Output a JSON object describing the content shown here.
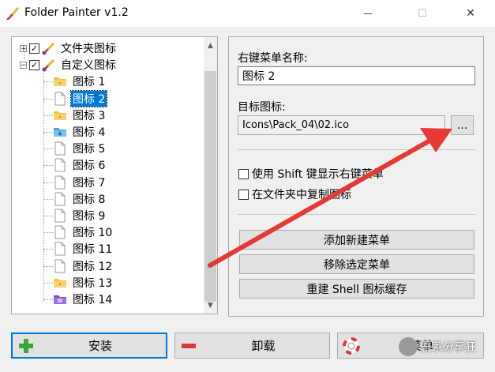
{
  "window": {
    "title": "Folder Painter v1.2",
    "minimize_glyph": "—",
    "maximize_glyph": "☐",
    "close_glyph": "✕"
  },
  "tree": {
    "nodes": [
      {
        "label": "文件夹图标",
        "level": 0,
        "expander": "+",
        "checked": true,
        "icon": "brush-icon"
      },
      {
        "label": "自定义图标",
        "level": 0,
        "expander": "−",
        "checked": true,
        "icon": "brush-icon"
      },
      {
        "label": "图标 1",
        "level": 1,
        "icon": "yellow-folder-icon"
      },
      {
        "label": "图标 2",
        "level": 1,
        "icon": "blank-file-icon",
        "selected": true
      },
      {
        "label": "图标 3",
        "level": 1,
        "icon": "yellow-folder-icon"
      },
      {
        "label": "图标 4",
        "level": 1,
        "icon": "blue-folder-icon"
      },
      {
        "label": "图标 5",
        "level": 1,
        "icon": "blank-file-icon"
      },
      {
        "label": "图标 6",
        "level": 1,
        "icon": "blank-file-icon"
      },
      {
        "label": "图标 7",
        "level": 1,
        "icon": "blank-file-icon"
      },
      {
        "label": "图标 8",
        "level": 1,
        "icon": "blank-file-icon"
      },
      {
        "label": "图标 9",
        "level": 1,
        "icon": "blank-file-icon"
      },
      {
        "label": "图标 10",
        "level": 1,
        "icon": "blank-file-icon"
      },
      {
        "label": "图标 11",
        "level": 1,
        "icon": "blank-file-icon"
      },
      {
        "label": "图标 12",
        "level": 1,
        "icon": "blank-file-icon"
      },
      {
        "label": "图标 13",
        "level": 1,
        "icon": "yellow-folder-icon"
      },
      {
        "label": "图标 14",
        "level": 1,
        "icon": "purple-folder-icon"
      }
    ]
  },
  "form": {
    "menu_name_label": "右键菜单名称:",
    "menu_name_value": "图标 2",
    "target_icon_label": "目标图标:",
    "target_icon_value": "Icons\\Pack_04\\02.ico",
    "browse_label": "...",
    "shift_checkbox_label": "使用 Shift 键显示右键菜单",
    "shift_checked": false,
    "copy_checkbox_label": "在文件夹中复制图标",
    "copy_checked": false,
    "add_menu_button": "添加新建菜单",
    "remove_menu_button": "移除选定菜单",
    "rebuild_cache_button": "重建 Shell 图标缓存"
  },
  "bottom": {
    "install_button": "安装",
    "uninstall_button": "卸载",
    "help_button": "菜单"
  },
  "watermark": {
    "text": "吾系分享狂"
  },
  "colors": {
    "accent": "#0078d7",
    "annotation_arrow": "#e53935",
    "install_green": "#38a838",
    "uninstall_red": "#d93a3a"
  }
}
